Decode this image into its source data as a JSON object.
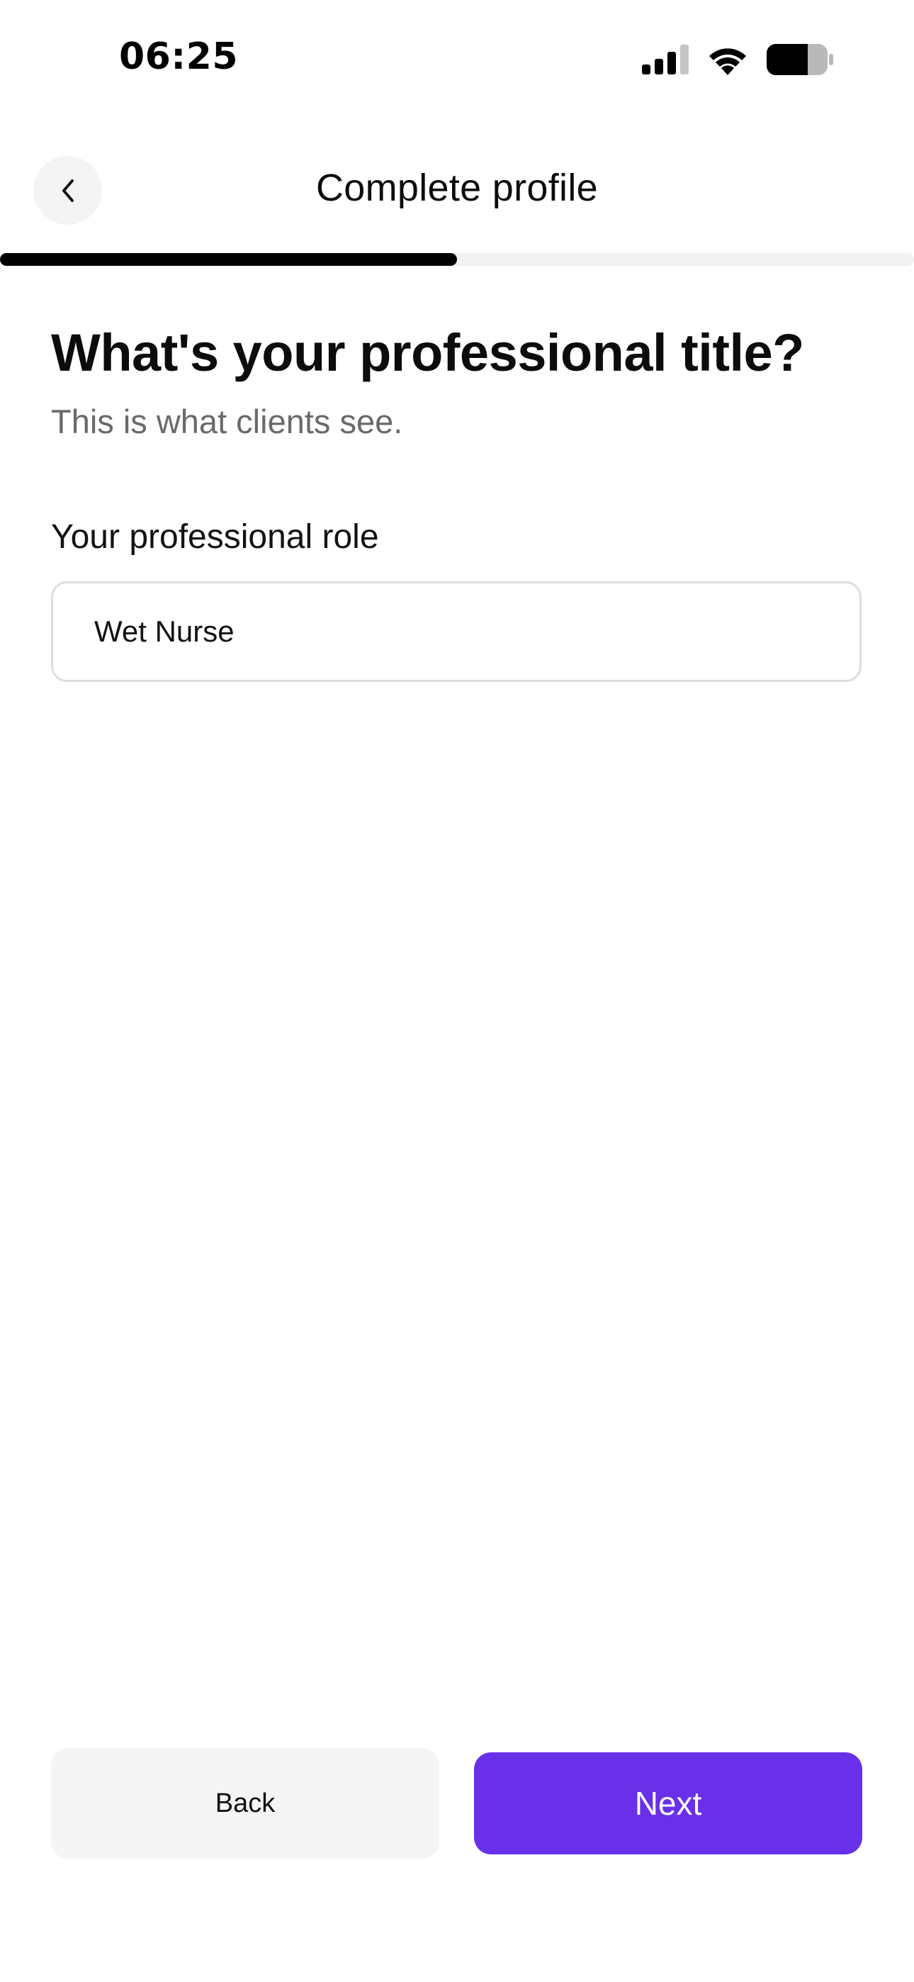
{
  "status_bar": {
    "time": "06:25",
    "icons": [
      "cellular-signal-icon",
      "wifi-icon",
      "battery-icon"
    ]
  },
  "header": {
    "back_icon": "chevron-left-icon",
    "title": "Complete profile"
  },
  "progress": {
    "fraction": 0.5
  },
  "content": {
    "heading": "What's your professional title?",
    "subheading": "This is what clients see.",
    "role_field": {
      "label": "Your professional role",
      "value": "Wet Nurse"
    }
  },
  "footer": {
    "back_label": "Back",
    "next_label": "Next"
  },
  "colors": {
    "accent": "#6930ea",
    "progress_fill": "#000000",
    "progress_track": "#f2f2f2",
    "secondary_button": "#f5f5f5",
    "subtitle_text": "#6a6a6a"
  }
}
